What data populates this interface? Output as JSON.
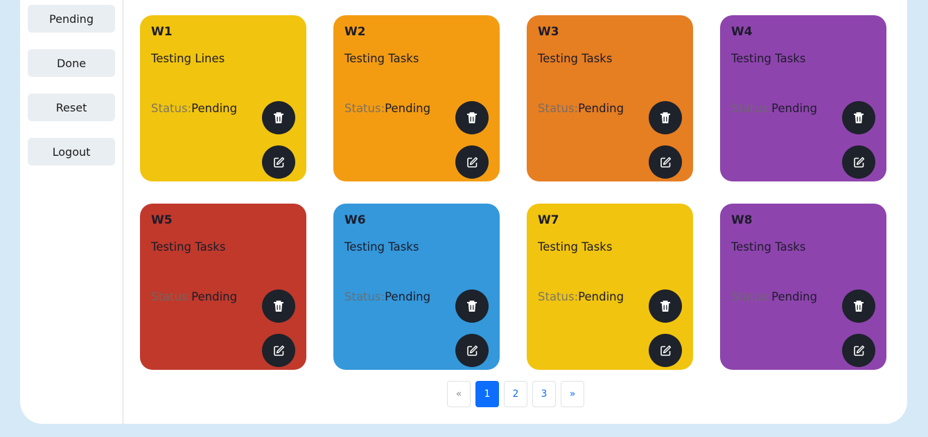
{
  "sidebar": {
    "buttons": [
      {
        "label": "Pending"
      },
      {
        "label": "Done"
      },
      {
        "label": "Reset"
      },
      {
        "label": "Logout"
      }
    ]
  },
  "cards": [
    {
      "title": "W1",
      "description": "Testing Lines",
      "status_label": "Status:",
      "status": "Pending",
      "color": "#f1c40f"
    },
    {
      "title": "W2",
      "description": "Testing Tasks",
      "status_label": "Status:",
      "status": "Pending",
      "color": "#f39c12"
    },
    {
      "title": "W3",
      "description": "Testing Tasks",
      "status_label": "Status:",
      "status": "Pending",
      "color": "#e67e22"
    },
    {
      "title": "W4",
      "description": "Testing Tasks",
      "status_label": "Status:",
      "status": "Pending",
      "color": "#8e44ad"
    },
    {
      "title": "W5",
      "description": "Testing Tasks",
      "status_label": "Status:",
      "status": "Pending",
      "color": "#c0392b"
    },
    {
      "title": "W6",
      "description": "Testing Tasks",
      "status_label": "Status:",
      "status": "Pending",
      "color": "#3498db"
    },
    {
      "title": "W7",
      "description": "Testing Tasks",
      "status_label": "Status:",
      "status": "Pending",
      "color": "#f1c40f"
    },
    {
      "title": "W8",
      "description": "Testing Tasks",
      "status_label": "Status:",
      "status": "Pending",
      "color": "#8e44ad"
    }
  ],
  "card_icons": {
    "delete": "trash-icon",
    "edit": "edit-icon"
  },
  "pagination": {
    "prev": "«",
    "pages": [
      "1",
      "2",
      "3"
    ],
    "active": "1",
    "next": "»"
  },
  "colors": {
    "background": "#d6e9f7",
    "icon_button": "#1d222b",
    "active_page": "#0d6efd"
  }
}
